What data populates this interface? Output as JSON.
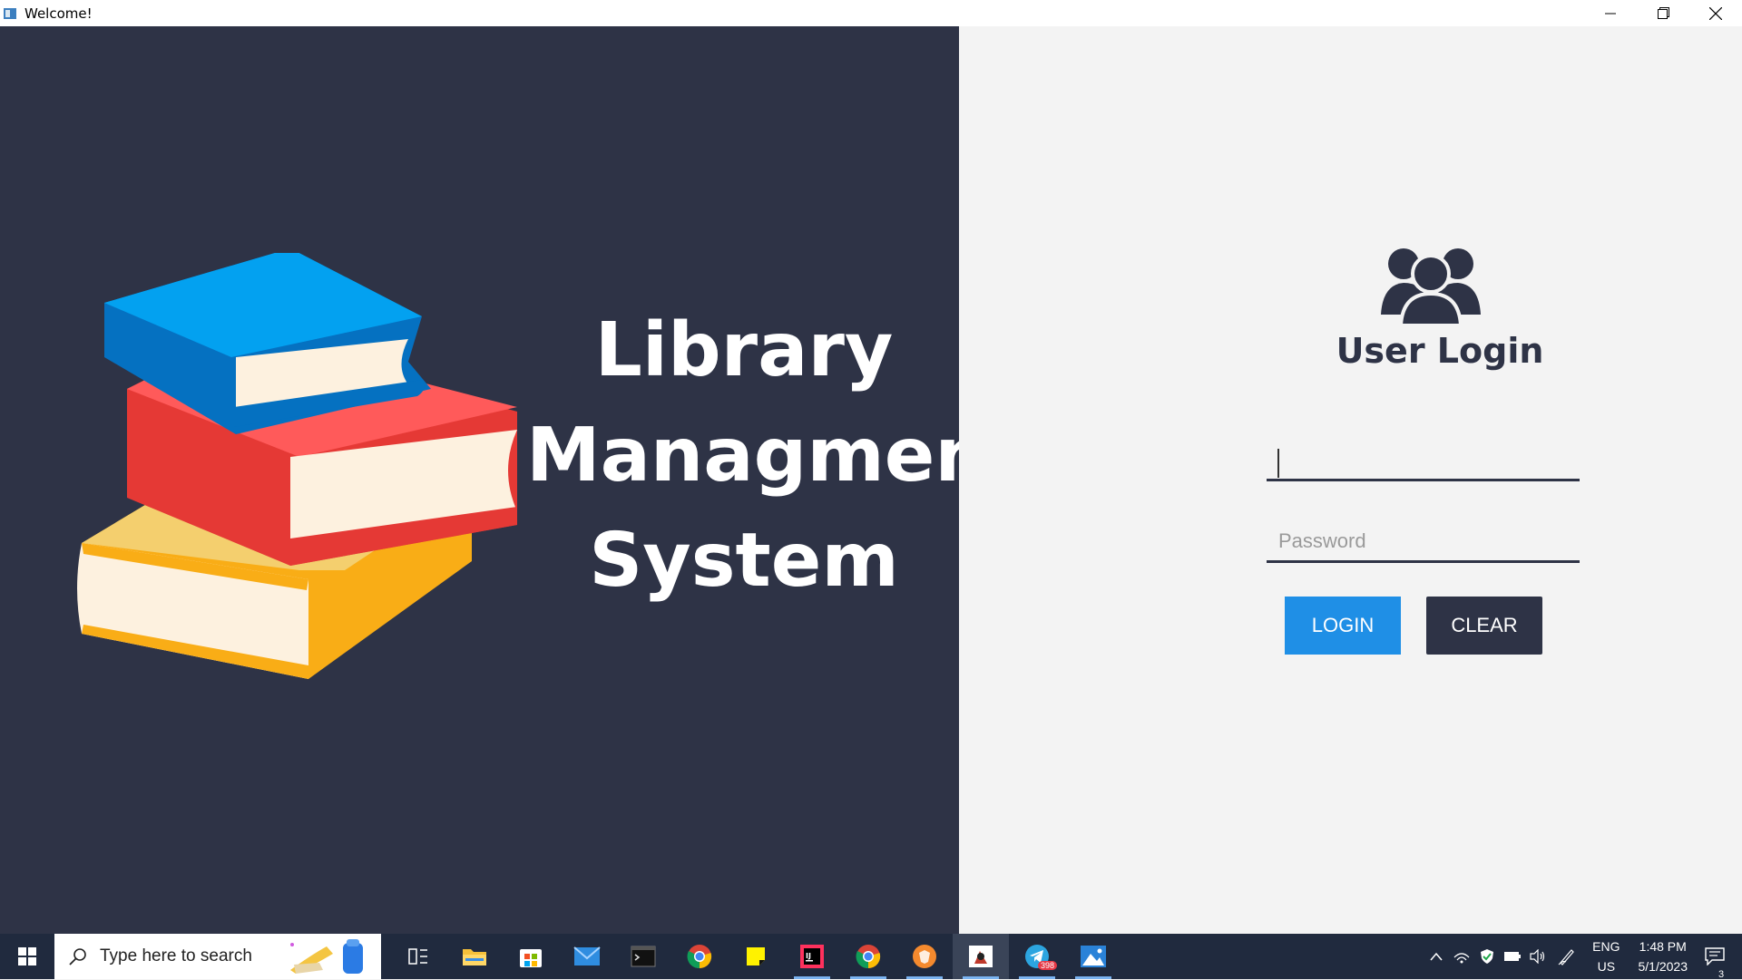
{
  "window": {
    "title": "Welcome!"
  },
  "hero": {
    "line1": "Library",
    "line2": "Managment",
    "line3": "System"
  },
  "login": {
    "title": "User Login",
    "username_value": "",
    "password_placeholder": "Password",
    "login_label": "LOGIN",
    "clear_label": "CLEAR"
  },
  "colors": {
    "dark_panel": "#2e3346",
    "accent_blue": "#1f8fe6",
    "light_panel": "#f3f3f3"
  },
  "taskbar": {
    "search_placeholder": "Type here to search",
    "apps": [
      "task-view-icon",
      "file-explorer-icon",
      "microsoft-store-icon",
      "mail-icon",
      "terminal-icon",
      "chrome-icon",
      "sticky-notes-icon",
      "intellij-icon",
      "chrome-icon",
      "brave-icon",
      "java-app-icon",
      "telegram-icon",
      "photos-icon"
    ],
    "telegram_badge": "398",
    "lang_line1": "ENG",
    "lang_line2": "US",
    "time": "1:48 PM",
    "date": "5/1/2023",
    "notification_count": "3"
  }
}
